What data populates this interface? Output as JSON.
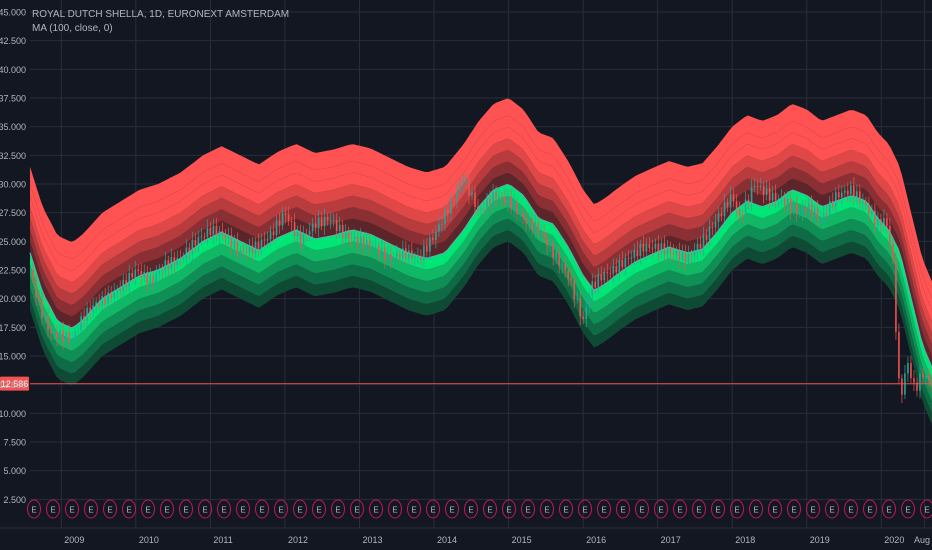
{
  "chart_data": {
    "type": "line",
    "title": "ROYAL DUTCH SHELLA, 1D, EURONEXT AMSTERDAM",
    "indicator": "MA (100, close, 0)",
    "ylim": [
      0,
      45
    ],
    "y_ticks": [
      "2.500",
      "5.000",
      "7.500",
      "10.000",
      "12.500",
      "15.000",
      "17.500",
      "20.000",
      "22.500",
      "25.000",
      "27.500",
      "30.000",
      "32.500",
      "35.000",
      "37.500",
      "40.000",
      "42.500",
      "45.000"
    ],
    "y_tick_values": [
      2.5,
      5,
      7.5,
      10,
      12.5,
      15,
      17.5,
      20,
      22.5,
      25,
      27.5,
      30,
      32.5,
      35,
      37.5,
      40,
      42.5,
      45
    ],
    "x_labels": [
      "2009",
      "2010",
      "2011",
      "2012",
      "2013",
      "2014",
      "2015",
      "2016",
      "2017",
      "2018",
      "2019",
      "2020",
      "Aug"
    ],
    "x_label_dates": [
      2009.0,
      2010.0,
      2011.0,
      2012.0,
      2013.0,
      2014.0,
      2015.0,
      2016.0,
      2017.0,
      2018.0,
      2019.0,
      2020.0,
      2020.58
    ],
    "x_range": [
      2008.58,
      2020.68
    ],
    "price_label": "12.586",
    "price_value": 12.586,
    "grid": true,
    "earnings_marker_glyph": "E",
    "earnings_count": 48,
    "colors": {
      "background": "#131722",
      "grid": "#2a2e39",
      "axis_text": "#b2b5be",
      "price_line": "#f05350",
      "ma_line": "#4db6ac",
      "candle_up": "#26a69a",
      "candle_down": "#ef5350",
      "bands_red": [
        "#ff5252",
        "#e04848",
        "#b83b3e",
        "#8a3034",
        "#5b252a"
      ],
      "bands_green": [
        "#0f4a35",
        "#0f6b45",
        "#0f8f56",
        "#10b866",
        "#00e676"
      ],
      "earnings_marker": "#c2185b"
    },
    "ma_series": {
      "x": [
        2008.58,
        2008.75,
        2008.95,
        2009.15,
        2009.3,
        2009.55,
        2009.8,
        2010.05,
        2010.3,
        2010.6,
        2010.9,
        2011.15,
        2011.4,
        2011.65,
        2011.9,
        2012.15,
        2012.4,
        2012.65,
        2012.9,
        2013.15,
        2013.4,
        2013.65,
        2013.9,
        2014.15,
        2014.4,
        2014.6,
        2014.8,
        2015.0,
        2015.2,
        2015.4,
        2015.6,
        2015.8,
        2016.0,
        2016.15,
        2016.3,
        2016.5,
        2016.7,
        2016.9,
        2017.15,
        2017.4,
        2017.6,
        2017.8,
        2018.0,
        2018.2,
        2018.4,
        2018.6,
        2018.8,
        2019.0,
        2019.2,
        2019.4,
        2019.6,
        2019.8,
        2019.95,
        2020.1,
        2020.25,
        2020.4,
        2020.55,
        2020.68
      ],
      "y": [
        24.0,
        20.5,
        18.0,
        17.4,
        18.2,
        20.0,
        21.0,
        22.0,
        22.5,
        23.5,
        25.0,
        25.8,
        25.0,
        24.2,
        25.3,
        26.0,
        25.2,
        25.5,
        26.0,
        25.6,
        24.8,
        24.0,
        23.5,
        24.0,
        26.0,
        28.0,
        29.5,
        30.0,
        29.0,
        27.0,
        26.5,
        24.5,
        22.0,
        20.7,
        21.3,
        22.3,
        23.2,
        23.8,
        24.5,
        24.0,
        24.3,
        25.8,
        27.5,
        28.5,
        28.0,
        28.5,
        29.5,
        29.0,
        28.0,
        28.5,
        29.0,
        28.5,
        27.0,
        26.0,
        24.0,
        20.0,
        16.0,
        14.0
      ]
    },
    "band_offsets": [
      -5.0,
      -4.0,
      -3.0,
      -2.0,
      -1.0,
      0,
      1.0,
      2.0,
      3.0,
      4.0,
      5.0,
      6.0,
      7.5
    ],
    "price_series": {
      "x": [
        2008.58,
        2008.7,
        2008.85,
        2009.0,
        2009.15,
        2009.3,
        2009.45,
        2009.6,
        2009.8,
        2010.0,
        2010.2,
        2010.4,
        2010.6,
        2010.8,
        2011.0,
        2011.2,
        2011.4,
        2011.6,
        2011.8,
        2012.0,
        2012.2,
        2012.4,
        2012.6,
        2012.8,
        2013.0,
        2013.2,
        2013.4,
        2013.6,
        2013.8,
        2014.0,
        2014.2,
        2014.4,
        2014.6,
        2014.8,
        2015.0,
        2015.2,
        2015.4,
        2015.6,
        2015.8,
        2016.0,
        2016.1,
        2016.25,
        2016.4,
        2016.6,
        2016.8,
        2017.0,
        2017.2,
        2017.4,
        2017.6,
        2017.8,
        2018.0,
        2018.1,
        2018.3,
        2018.5,
        2018.7,
        2018.9,
        2019.0,
        2019.2,
        2019.4,
        2019.6,
        2019.8,
        2019.95,
        2020.05,
        2020.15,
        2020.2,
        2020.25,
        2020.35,
        2020.45,
        2020.55,
        2020.68
      ],
      "y": [
        22.5,
        19.5,
        17.0,
        16.8,
        16.5,
        18.5,
        19.5,
        20.0,
        21.0,
        22.5,
        21.5,
        23.0,
        23.5,
        25.0,
        26.0,
        25.5,
        24.0,
        24.5,
        25.5,
        27.5,
        25.0,
        26.5,
        27.0,
        25.5,
        25.0,
        24.5,
        23.5,
        24.0,
        23.5,
        25.5,
        28.0,
        30.5,
        27.5,
        29.0,
        28.5,
        27.0,
        26.0,
        24.0,
        22.0,
        18.0,
        21.0,
        22.0,
        22.5,
        23.5,
        24.5,
        24.5,
        24.0,
        23.5,
        25.0,
        27.0,
        29.0,
        27.0,
        30.0,
        29.0,
        28.5,
        27.5,
        28.0,
        27.0,
        29.0,
        29.5,
        28.0,
        26.5,
        27.0,
        24.0,
        17.0,
        11.0,
        14.5,
        12.0,
        13.5,
        12.6
      ]
    }
  }
}
